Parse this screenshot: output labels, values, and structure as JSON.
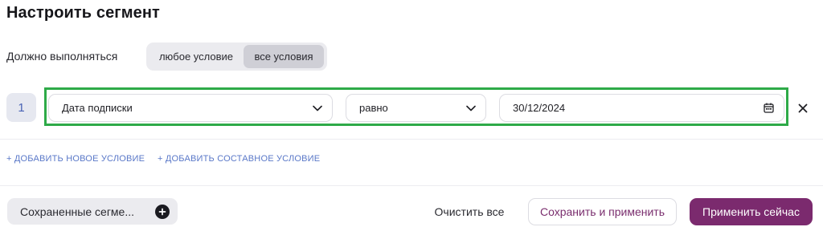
{
  "header": {
    "title": "Настроить сегмент"
  },
  "match": {
    "label": "Должно выполняться",
    "options": [
      "любое условие",
      "все условия"
    ],
    "selected": "все условия"
  },
  "condition": {
    "number": "1",
    "attribute": "Дата подписки",
    "operator": "равно",
    "value": "30/12/2024"
  },
  "links": {
    "add_condition": "+ ДОБАВИТЬ НОВОЕ УСЛОВИЕ",
    "add_compound": "+ ДОБАВИТЬ СОСТАВНОЕ УСЛОВИЕ"
  },
  "footer": {
    "saved_segments": "Сохраненные сегме...",
    "clear_all": "Очистить все",
    "save_apply": "Сохранить и применить",
    "apply_now": "Применить сейчас"
  },
  "colors": {
    "highlight": "#2eaa48",
    "primary": "#7b2a6e",
    "link": "#5a78c8"
  }
}
